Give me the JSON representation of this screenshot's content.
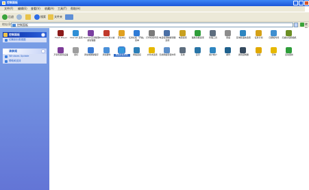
{
  "window": {
    "title": "控制面板"
  },
  "menubar": [
    "文件(F)",
    "编辑(E)",
    "查看(V)",
    "收藏(A)",
    "工具(T)",
    "帮助(H)"
  ],
  "toolbar": {
    "back_label": "后退",
    "search_label": "搜索",
    "folders_label": "文件夹"
  },
  "address": {
    "label": "地址(D)",
    "value": "控制面板",
    "go_label": "转到"
  },
  "left_pane": {
    "panel1": {
      "title": "控制面板",
      "items": [
        "切换到分类视图"
      ]
    },
    "panel2": {
      "title": "请参阅",
      "items": [
        "Windows Update",
        "帮助和支持"
      ]
    }
  },
  "items": [
    {
      "label": "Flash Player",
      "color": "#8b1a1a"
    },
    {
      "label": "Internet 选项",
      "color": "#2f8fd6"
    },
    {
      "label": "Realtek高清晰音频管理器",
      "color": "#7a3fa0"
    },
    {
      "label": "Windows 防火墙",
      "color": "#c0392b"
    },
    {
      "label": "安全中心",
      "color": "#e0a020"
    },
    {
      "label": "任务栏和「开始」菜单",
      "color": "#2e7bd6"
    },
    {
      "label": "打印机和传真",
      "color": "#7a7a7a"
    },
    {
      "label": "电话和调制解调器选项",
      "color": "#4a6fa5"
    },
    {
      "label": "电源选项",
      "color": "#c8a020"
    },
    {
      "label": "辅助功能选项",
      "color": "#2e9d3a"
    },
    {
      "label": "管理工具",
      "color": "#5d6d7e"
    },
    {
      "label": "键盘",
      "color": "#8c8c8c"
    },
    {
      "label": "区域和语言选项",
      "color": "#2e86c1"
    },
    {
      "label": "任务计划",
      "color": "#d4a017"
    },
    {
      "label": "日期和时间",
      "color": "#3f8fd0"
    },
    {
      "label": "扫描仪和照相机",
      "color": "#6b8e23"
    },
    {
      "label": "声音和音频设备",
      "color": "#7d3c98"
    },
    {
      "label": "鼠标",
      "color": "#9e9e9e"
    },
    {
      "label": "添加或删除程序",
      "color": "#3a7bd5"
    },
    {
      "label": "添加硬件",
      "color": "#4a90d9"
    },
    {
      "label": "网络安装向导",
      "color": "#3498db"
    },
    {
      "label": "网络连接",
      "color": "#2c7fb8"
    },
    {
      "label": "文件夹选项",
      "color": "#e6b800"
    },
    {
      "label": "无线网络安装向导",
      "color": "#5d8fc9"
    },
    {
      "label": "系统",
      "color": "#5d6d7e"
    },
    {
      "label": "显示",
      "color": "#2874a6"
    },
    {
      "label": "用户帐户",
      "color": "#2e86c1"
    },
    {
      "label": "邮件",
      "color": "#1f618d"
    },
    {
      "label": "游戏控制器",
      "color": "#34495e"
    },
    {
      "label": "语音",
      "color": "#e0a800"
    },
    {
      "label": "字体",
      "color": "#e6b800"
    },
    {
      "label": "自动更新",
      "color": "#2e9d3a"
    }
  ],
  "selected_item": "网络安装向导"
}
